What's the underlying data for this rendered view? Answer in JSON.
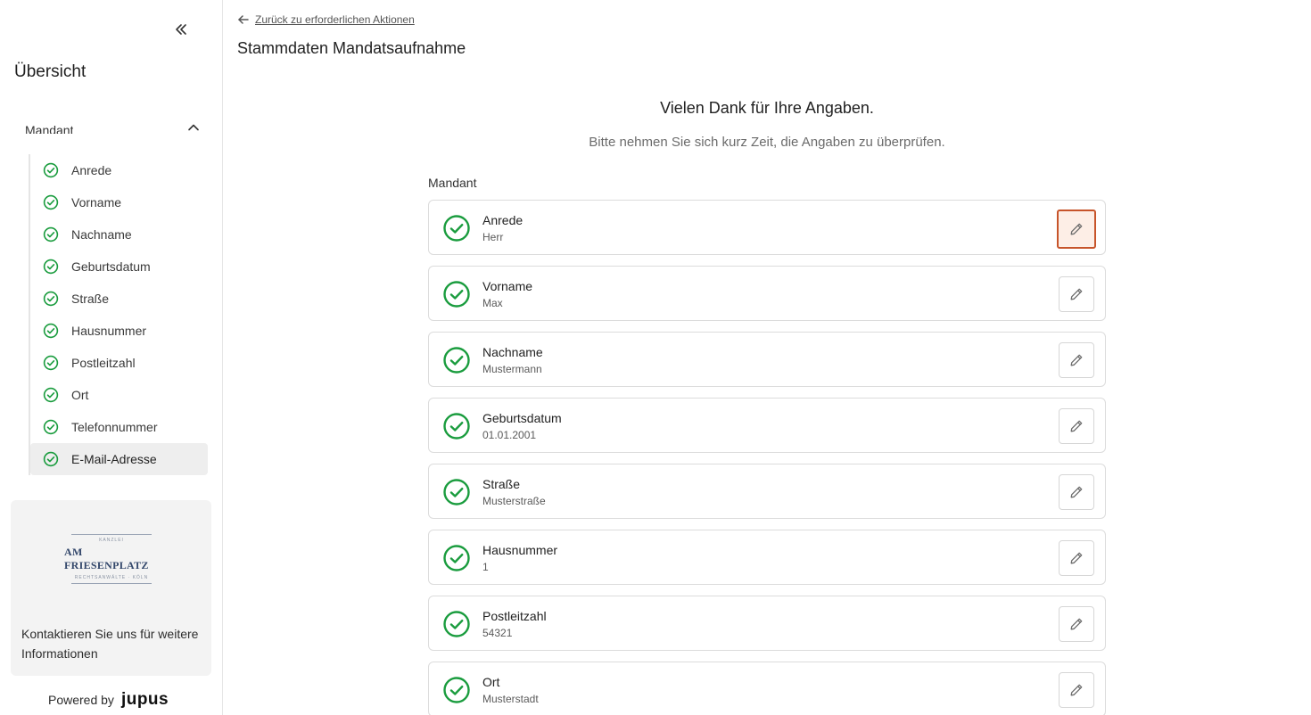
{
  "sidebar": {
    "overview_title": "Übersicht",
    "section_label": "Mandant",
    "items": [
      {
        "label": "Anrede"
      },
      {
        "label": "Vorname"
      },
      {
        "label": "Nachname"
      },
      {
        "label": "Geburtsdatum"
      },
      {
        "label": "Straße"
      },
      {
        "label": "Hausnummer"
      },
      {
        "label": "Postleitzahl"
      },
      {
        "label": "Ort"
      },
      {
        "label": "Telefonnummer"
      },
      {
        "label": "E-Mail-Adresse"
      }
    ],
    "active_item": "E-Mail-Adresse",
    "logo": {
      "name": "AM FRIESENPLATZ",
      "top": "KANZLEI",
      "bottom": "RECHTSANWÄLTE · KÖLN"
    },
    "contact_text": "Kontaktieren Sie uns für weitere Informationen",
    "powered_by": "Powered by",
    "brand": "jupus"
  },
  "main": {
    "back_link": "Zurück zu erforderlichen Aktionen",
    "page_title": "Stammdaten Mandatsaufnahme",
    "thanks": "Vielen Dank für Ihre Angaben.",
    "hint": "Bitte nehmen Sie sich kurz Zeit, die Angaben zu überprüfen.",
    "group_label": "Mandant",
    "fields": [
      {
        "label": "Anrede",
        "value": "Herr"
      },
      {
        "label": "Vorname",
        "value": "Max"
      },
      {
        "label": "Nachname",
        "value": "Mustermann"
      },
      {
        "label": "Geburtsdatum",
        "value": "01.01.2001"
      },
      {
        "label": "Straße",
        "value": "Musterstraße"
      },
      {
        "label": "Hausnummer",
        "value": "1"
      },
      {
        "label": "Postleitzahl",
        "value": "54321"
      },
      {
        "label": "Ort",
        "value": "Musterstadt"
      }
    ]
  },
  "colors": {
    "check": "#1a9c3e",
    "focus": "#c7542a"
  },
  "icons": {
    "collapse": "chevrons-left-icon",
    "chevron": "chevron-up-icon",
    "check": "check-circle-icon",
    "edit": "pencil-icon",
    "back": "arrow-left-icon"
  }
}
